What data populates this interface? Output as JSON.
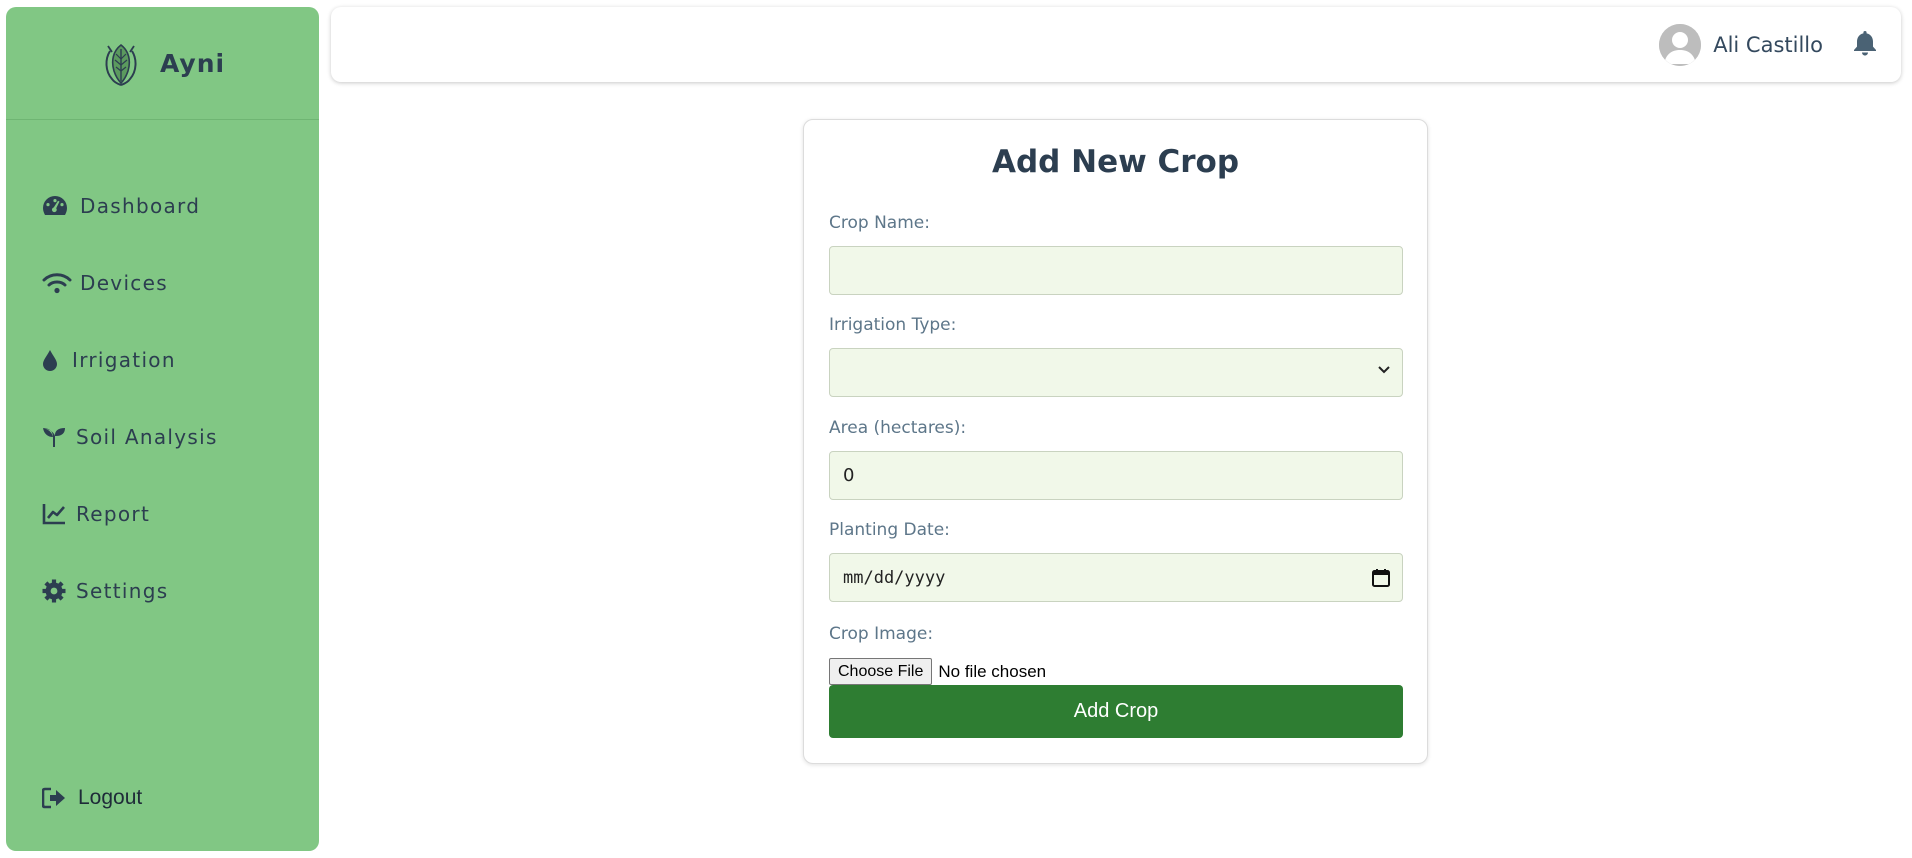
{
  "brand": {
    "name": "Ayni",
    "logo": "leaf-hand-logo"
  },
  "sidebar": {
    "items": [
      {
        "label": "Dashboard",
        "icon": "gauge-icon"
      },
      {
        "label": "Devices",
        "icon": "wifi-icon"
      },
      {
        "label": "Irrigation",
        "icon": "droplet-icon"
      },
      {
        "label": "Soil Analysis",
        "icon": "seedling-icon"
      },
      {
        "label": "Report",
        "icon": "line-chart-icon"
      },
      {
        "label": "Settings",
        "icon": "gear-icon"
      }
    ],
    "logout": {
      "label": "Logout",
      "icon": "logout-icon"
    }
  },
  "header": {
    "user_name": "Ali Castillo",
    "avatar_icon": "user-avatar-icon",
    "bell_icon": "bell-icon"
  },
  "form": {
    "title": "Add New Crop",
    "crop_name": {
      "label": "Crop Name:",
      "value": ""
    },
    "irrigation_type": {
      "label": "Irrigation Type:",
      "value": ""
    },
    "area": {
      "label": "Area (hectares):",
      "value": "0"
    },
    "planting_date": {
      "label": "Planting Date:",
      "placeholder": "mm/dd/yyyy"
    },
    "crop_image": {
      "label": "Crop Image:",
      "button": "Choose File",
      "status": "No file chosen"
    },
    "submit_label": "Add Crop"
  },
  "colors": {
    "sidebar_bg": "#81c784",
    "field_bg": "#f1f8e9",
    "primary_button": "#2e7d32",
    "text": "#2c3e50"
  }
}
